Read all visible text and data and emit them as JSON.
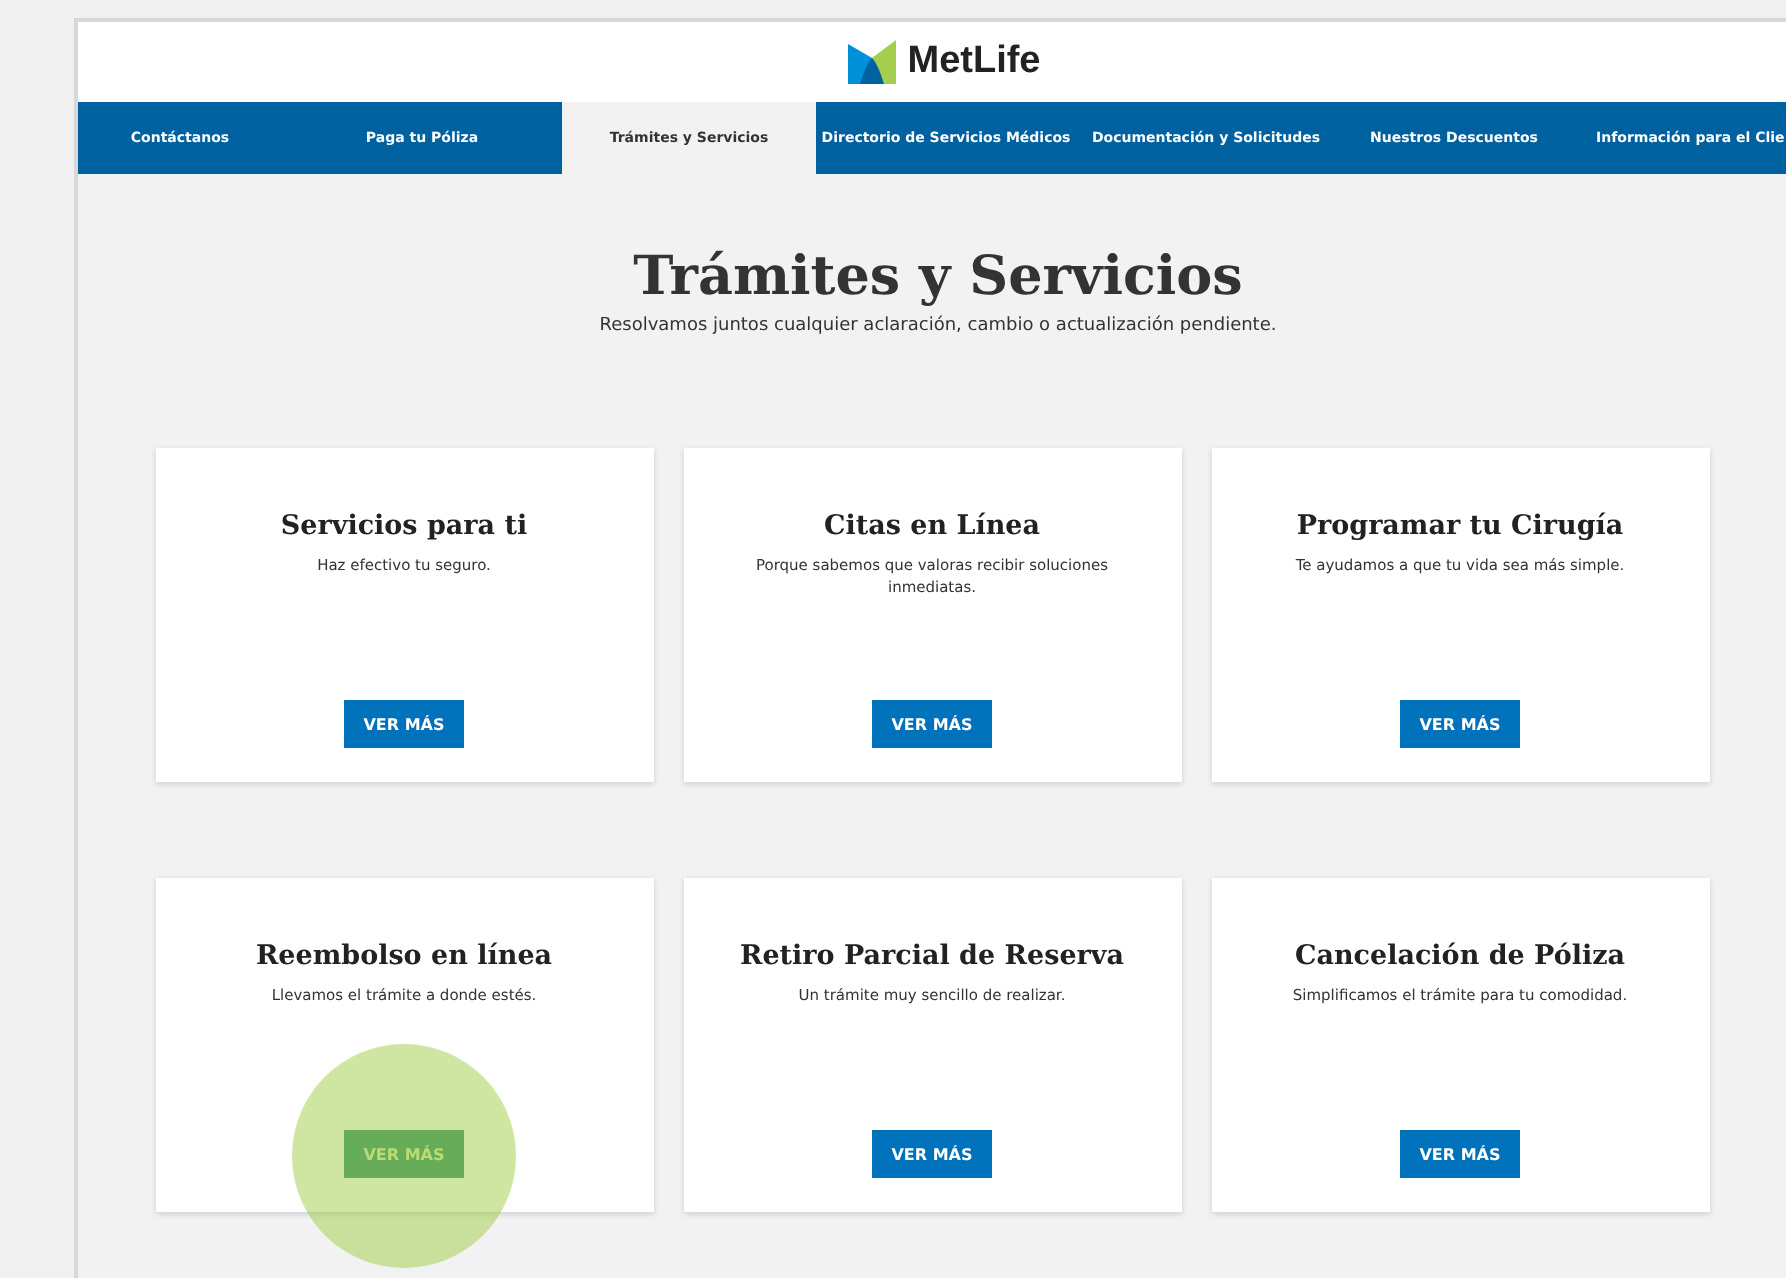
{
  "header": {
    "brand": "MetLife"
  },
  "nav": [
    {
      "label": "Contáctanos",
      "selected": false
    },
    {
      "label": "Paga tu Póliza",
      "selected": false
    },
    {
      "label": "Trámites y Servicios",
      "selected": true
    },
    {
      "label": "Directorio de Servicios Médicos",
      "selected": false
    },
    {
      "label": "Documentación y Solicitudes",
      "selected": false
    },
    {
      "label": "Nuestros Descuentos",
      "selected": false
    },
    {
      "label": "Información para el Clie",
      "selected": false
    }
  ],
  "title": "Trámites y Servicios",
  "subtitle": "Resolvamos juntos cualquier aclaración, cambio o actualización pendiente.",
  "cards": [
    {
      "title": "Servicios para ti",
      "text": "Haz efectivo tu seguro.",
      "button": "VER MÁS",
      "tapped": false
    },
    {
      "title": "Citas en Línea",
      "text": "Porque sabemos que valoras recibir soluciones inmediatas.",
      "button": "VER MÁS",
      "tapped": false
    },
    {
      "title": "Programar tu Cirugía",
      "text": "Te ayudamos a que tu vida sea más simple.",
      "button": "VER MÁS",
      "tapped": false
    },
    {
      "title": "Reembolso en línea",
      "text": "Llevamos el trámite a donde estés.",
      "button": "VER MÁS",
      "tapped": true
    },
    {
      "title": "Retiro Parcial de Reserva",
      "text": "Un trámite muy sencillo de realizar.",
      "button": "VER MÁS",
      "tapped": false
    },
    {
      "title": "Cancelación de Póliza",
      "text": "Simplificamos el trámite para tu comodidad.",
      "button": "VER MÁS",
      "tapped": false
    }
  ]
}
